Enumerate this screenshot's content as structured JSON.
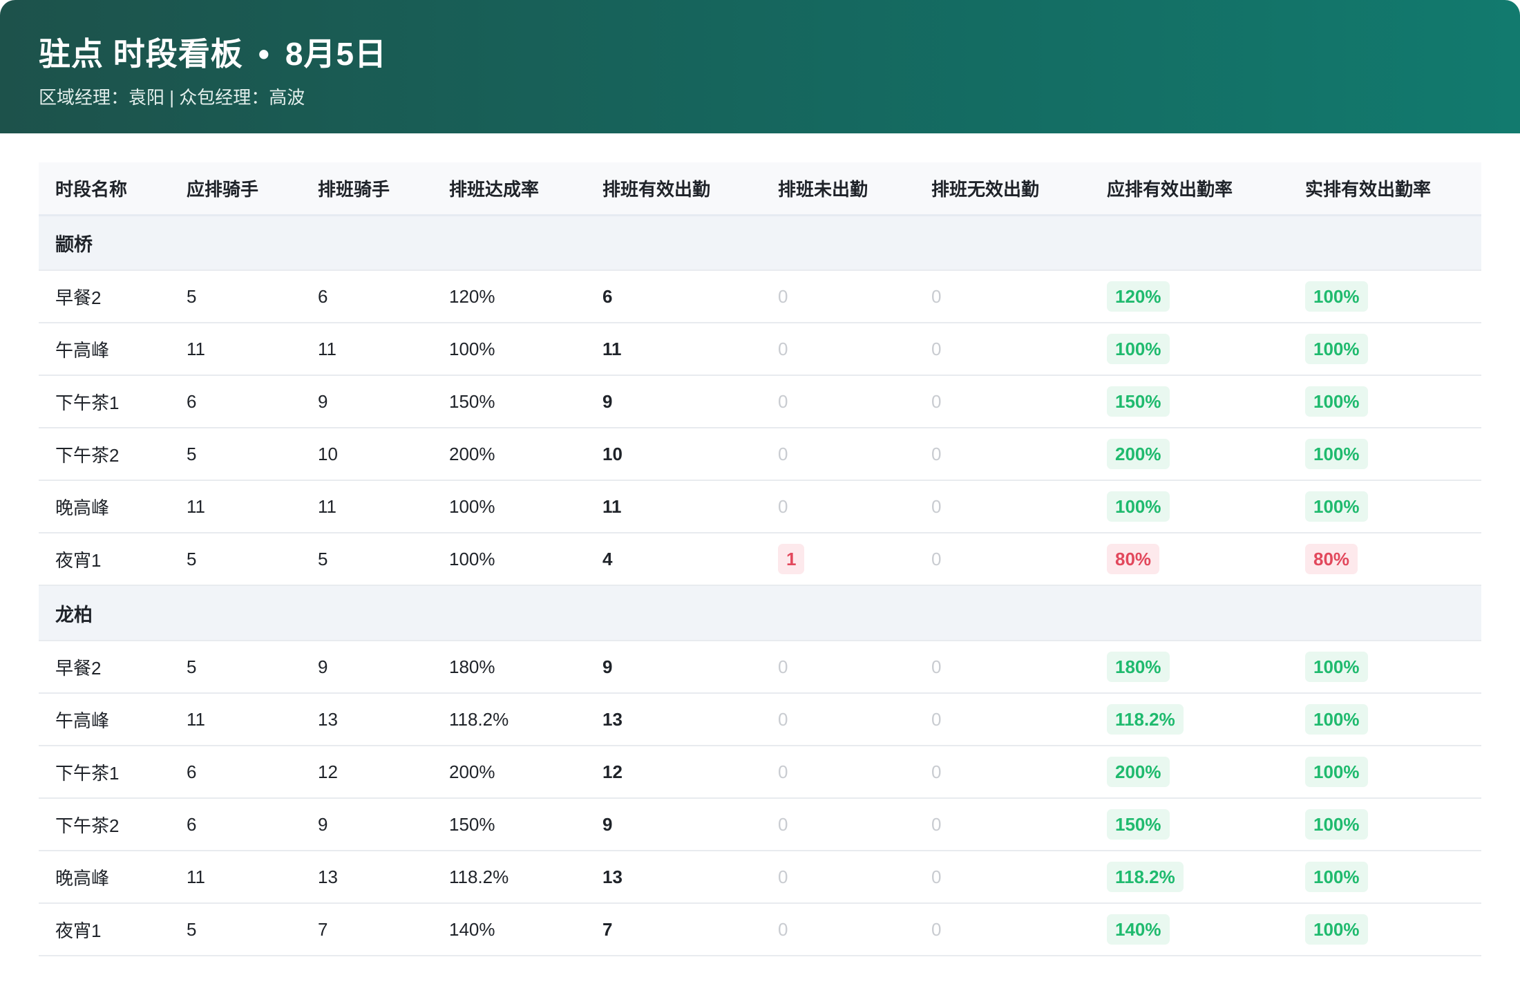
{
  "header": {
    "title_left": "驻点 时段看板",
    "title_dot": "•",
    "title_date": "8月5日",
    "subtitle": "区域经理：袁阳 | 众包经理：高波"
  },
  "colors": {
    "header_gradient_start": "#1d524b",
    "header_gradient_end": "#127a6e",
    "good": "#1fba6e",
    "good_bg": "#e9f8f0",
    "bad": "#e2485c",
    "bad_bg": "#fde9ec",
    "muted": "#c9ccd1"
  },
  "table": {
    "columns": [
      "时段名称",
      "应排骑手",
      "排班骑手",
      "排班达成率",
      "排班有效出勤",
      "排班未出勤",
      "排班无效出勤",
      "应排有效出勤率",
      "实排有效出勤率"
    ],
    "groups": [
      {
        "name": "颛桥",
        "rows": [
          {
            "period": "早餐2",
            "required": "5",
            "scheduled": "6",
            "rate": "120%",
            "valid": "6",
            "absent": "0",
            "invalid": "0",
            "req_valid_rate": "120%",
            "req_status": "good",
            "act_valid_rate": "100%",
            "act_status": "good"
          },
          {
            "period": "午高峰",
            "required": "11",
            "scheduled": "11",
            "rate": "100%",
            "valid": "11",
            "absent": "0",
            "invalid": "0",
            "req_valid_rate": "100%",
            "req_status": "good",
            "act_valid_rate": "100%",
            "act_status": "good"
          },
          {
            "period": "下午茶1",
            "required": "6",
            "scheduled": "9",
            "rate": "150%",
            "valid": "9",
            "absent": "0",
            "invalid": "0",
            "req_valid_rate": "150%",
            "req_status": "good",
            "act_valid_rate": "100%",
            "act_status": "good"
          },
          {
            "period": "下午茶2",
            "required": "5",
            "scheduled": "10",
            "rate": "200%",
            "valid": "10",
            "absent": "0",
            "invalid": "0",
            "req_valid_rate": "200%",
            "req_status": "good",
            "act_valid_rate": "100%",
            "act_status": "good"
          },
          {
            "period": "晚高峰",
            "required": "11",
            "scheduled": "11",
            "rate": "100%",
            "valid": "11",
            "absent": "0",
            "invalid": "0",
            "req_valid_rate": "100%",
            "req_status": "good",
            "act_valid_rate": "100%",
            "act_status": "good"
          },
          {
            "period": "夜宵1",
            "required": "5",
            "scheduled": "5",
            "rate": "100%",
            "valid": "4",
            "absent": "1",
            "invalid": "0",
            "req_valid_rate": "80%",
            "req_status": "bad",
            "act_valid_rate": "80%",
            "act_status": "bad"
          }
        ]
      },
      {
        "name": "龙柏",
        "rows": [
          {
            "period": "早餐2",
            "required": "5",
            "scheduled": "9",
            "rate": "180%",
            "valid": "9",
            "absent": "0",
            "invalid": "0",
            "req_valid_rate": "180%",
            "req_status": "good",
            "act_valid_rate": "100%",
            "act_status": "good"
          },
          {
            "period": "午高峰",
            "required": "11",
            "scheduled": "13",
            "rate": "118.2%",
            "valid": "13",
            "absent": "0",
            "invalid": "0",
            "req_valid_rate": "118.2%",
            "req_status": "good",
            "act_valid_rate": "100%",
            "act_status": "good"
          },
          {
            "period": "下午茶1",
            "required": "6",
            "scheduled": "12",
            "rate": "200%",
            "valid": "12",
            "absent": "0",
            "invalid": "0",
            "req_valid_rate": "200%",
            "req_status": "good",
            "act_valid_rate": "100%",
            "act_status": "good"
          },
          {
            "period": "下午茶2",
            "required": "6",
            "scheduled": "9",
            "rate": "150%",
            "valid": "9",
            "absent": "0",
            "invalid": "0",
            "req_valid_rate": "150%",
            "req_status": "good",
            "act_valid_rate": "100%",
            "act_status": "good"
          },
          {
            "period": "晚高峰",
            "required": "11",
            "scheduled": "13",
            "rate": "118.2%",
            "valid": "13",
            "absent": "0",
            "invalid": "0",
            "req_valid_rate": "118.2%",
            "req_status": "good",
            "act_valid_rate": "100%",
            "act_status": "good"
          },
          {
            "period": "夜宵1",
            "required": "5",
            "scheduled": "7",
            "rate": "140%",
            "valid": "7",
            "absent": "0",
            "invalid": "0",
            "req_valid_rate": "140%",
            "req_status": "good",
            "act_valid_rate": "100%",
            "act_status": "good"
          }
        ]
      }
    ]
  }
}
